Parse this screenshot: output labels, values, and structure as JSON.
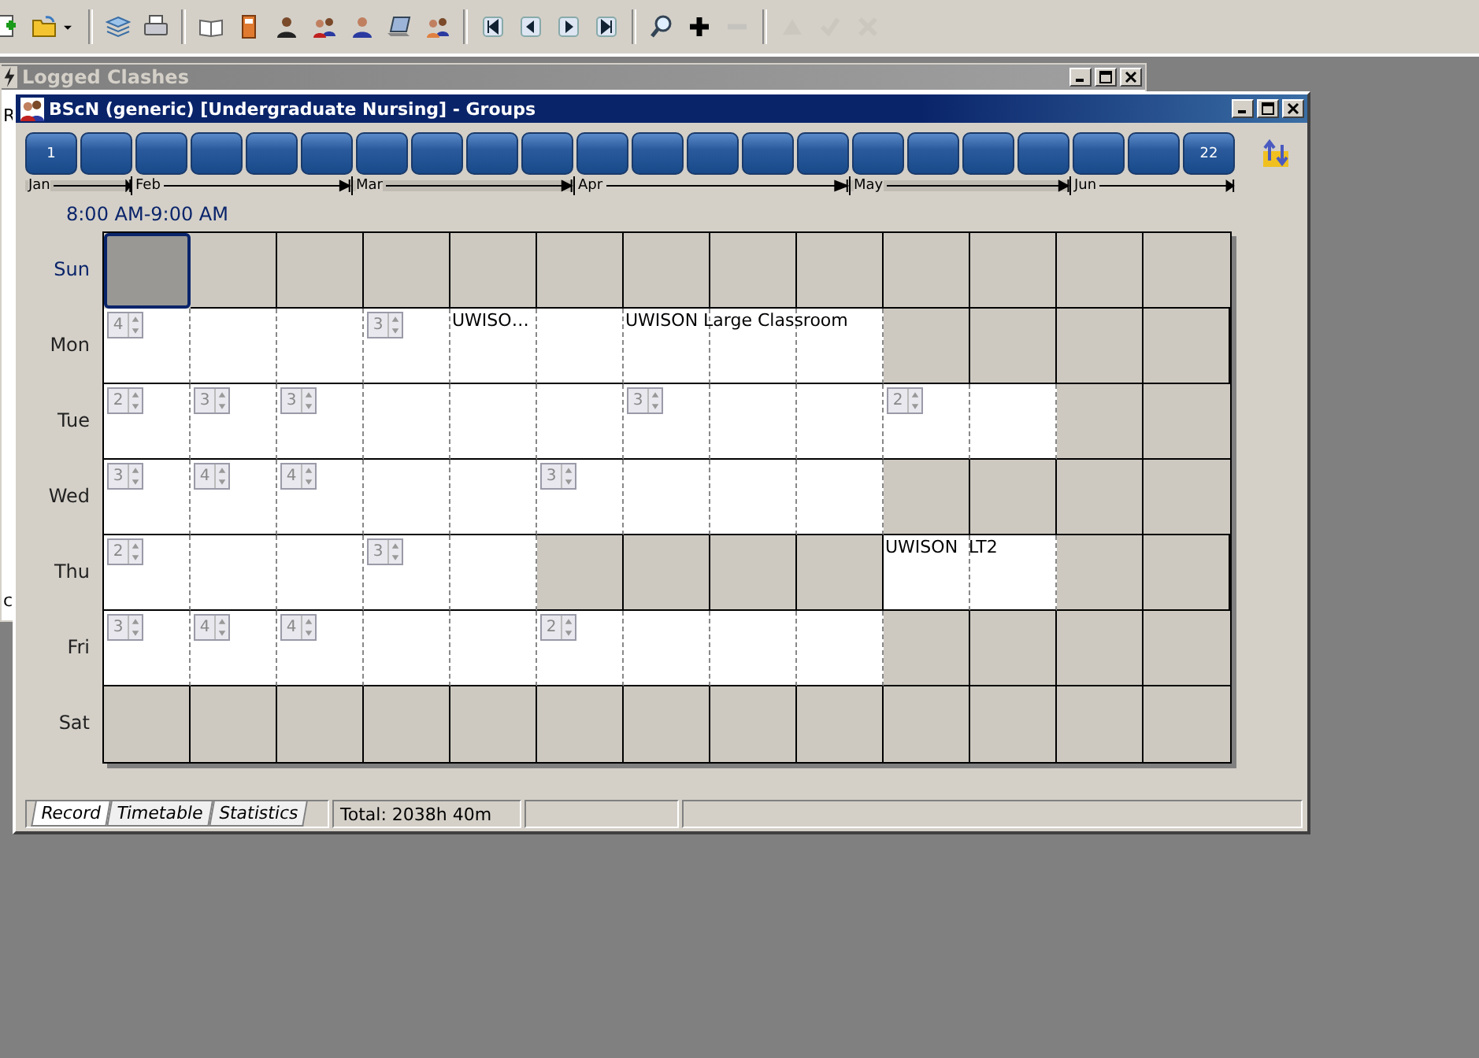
{
  "toolbar": [
    [
      {
        "kind": "new",
        "disabled": false
      },
      {
        "kind": "open",
        "disabled": false
      },
      {
        "kind": "caret",
        "disabled": false
      }
    ],
    [
      {
        "kind": "layers",
        "disabled": false
      },
      {
        "kind": "printer",
        "disabled": false
      }
    ],
    [
      {
        "kind": "book",
        "disabled": false
      },
      {
        "kind": "door",
        "disabled": false
      },
      {
        "kind": "person",
        "disabled": false
      },
      {
        "kind": "people",
        "disabled": false
      },
      {
        "kind": "person2",
        "disabled": false
      },
      {
        "kind": "laptop",
        "disabled": false
      },
      {
        "kind": "people2",
        "disabled": false
      }
    ],
    [
      {
        "kind": "first",
        "disabled": false
      },
      {
        "kind": "prev",
        "disabled": false
      },
      {
        "kind": "next",
        "disabled": false
      },
      {
        "kind": "last",
        "disabled": false
      }
    ],
    [
      {
        "kind": "search",
        "disabled": false
      },
      {
        "kind": "plus",
        "disabled": false
      },
      {
        "kind": "minus",
        "disabled": true
      }
    ],
    [
      {
        "kind": "up",
        "disabled": true
      },
      {
        "kind": "check",
        "disabled": true
      },
      {
        "kind": "cross",
        "disabled": true
      }
    ]
  ],
  "back_window": {
    "title": "Logged Clashes",
    "fragments": [
      "R",
      "c"
    ]
  },
  "window": {
    "title": "BScN (generic) [Undergraduate Nursing] - Groups"
  },
  "weeks": [
    {
      "kind": "numbered",
      "label": "1"
    },
    {
      "kind": "plain"
    },
    {
      "kind": "plain"
    },
    {
      "kind": "plain"
    },
    {
      "kind": "plain"
    },
    {
      "kind": "plain"
    },
    {
      "kind": "plain"
    },
    {
      "kind": "plain"
    },
    {
      "kind": "plain"
    },
    {
      "kind": "plain"
    },
    {
      "kind": "plain"
    },
    {
      "kind": "plain"
    },
    {
      "kind": "plain"
    },
    {
      "kind": "plain"
    },
    {
      "kind": "plain"
    },
    {
      "kind": "plain"
    },
    {
      "kind": "plain"
    },
    {
      "kind": "plain"
    },
    {
      "kind": "plain"
    },
    {
      "kind": "plain"
    },
    {
      "kind": "plain"
    },
    {
      "kind": "numbered",
      "label": "22"
    }
  ],
  "months": [
    "Jan",
    "Feb",
    "Mar",
    "Apr",
    "May",
    "Jun"
  ],
  "time_label": "8:00 AM-9:00 AM",
  "days": [
    {
      "label": "Sun",
      "selected": true,
      "cells": [
        {
          "busy": true,
          "selected": true
        },
        {
          "busy": true,
          "selected": false
        },
        {
          "busy": true,
          "selected": false
        },
        {
          "busy": true,
          "selected": false
        },
        {
          "busy": true,
          "selected": false
        },
        {
          "busy": true,
          "selected": false
        },
        {
          "busy": true,
          "selected": false
        },
        {
          "busy": true,
          "selected": false
        },
        {
          "busy": true,
          "selected": false
        },
        {
          "busy": true,
          "selected": false
        },
        {
          "busy": true,
          "selected": false
        },
        {
          "busy": true,
          "selected": false
        },
        {
          "busy": true,
          "selected": false
        }
      ]
    },
    {
      "label": "Mon",
      "selected": false,
      "cells": [
        {
          "busy": false,
          "selected": false,
          "count": "4"
        },
        {
          "busy": false,
          "selected": false
        },
        {
          "busy": false,
          "selected": false
        },
        {
          "busy": false,
          "selected": false,
          "count": "3"
        },
        {
          "busy": false,
          "selected": false,
          "text": "UWISO…"
        },
        {
          "busy": false,
          "selected": false
        },
        {
          "busy": false,
          "selected": false,
          "text": "UWISON Large Classroom"
        },
        {
          "busy": false,
          "selected": false
        },
        {
          "busy": false,
          "selected": false
        },
        {
          "busy": true,
          "selected": false
        },
        {
          "busy": true,
          "selected": false
        },
        {
          "busy": true,
          "selected": false
        },
        {
          "busy": true,
          "selected": false
        }
      ]
    },
    {
      "label": "Tue",
      "selected": false,
      "cells": [
        {
          "busy": false,
          "selected": false,
          "count": "2"
        },
        {
          "busy": false,
          "selected": false,
          "count": "3"
        },
        {
          "busy": false,
          "selected": false,
          "count": "3"
        },
        {
          "busy": false,
          "selected": false
        },
        {
          "busy": false,
          "selected": false
        },
        {
          "busy": false,
          "selected": false
        },
        {
          "busy": false,
          "selected": false,
          "count": "3"
        },
        {
          "busy": false,
          "selected": false
        },
        {
          "busy": false,
          "selected": false
        },
        {
          "busy": false,
          "selected": false,
          "count": "2"
        },
        {
          "busy": false,
          "selected": false
        },
        {
          "busy": true,
          "selected": false
        },
        {
          "busy": true,
          "selected": false
        }
      ]
    },
    {
      "label": "Wed",
      "selected": false,
      "cells": [
        {
          "busy": false,
          "selected": false,
          "count": "3"
        },
        {
          "busy": false,
          "selected": false,
          "count": "4"
        },
        {
          "busy": false,
          "selected": false,
          "count": "4"
        },
        {
          "busy": false,
          "selected": false
        },
        {
          "busy": false,
          "selected": false
        },
        {
          "busy": false,
          "selected": false,
          "count": "3"
        },
        {
          "busy": false,
          "selected": false
        },
        {
          "busy": false,
          "selected": false
        },
        {
          "busy": false,
          "selected": false
        },
        {
          "busy": true,
          "selected": false
        },
        {
          "busy": true,
          "selected": false
        },
        {
          "busy": true,
          "selected": false
        },
        {
          "busy": true,
          "selected": false
        }
      ]
    },
    {
      "label": "Thu",
      "selected": false,
      "cells": [
        {
          "busy": false,
          "selected": false,
          "count": "2"
        },
        {
          "busy": false,
          "selected": false
        },
        {
          "busy": false,
          "selected": false
        },
        {
          "busy": false,
          "selected": false,
          "count": "3"
        },
        {
          "busy": false,
          "selected": false
        },
        {
          "busy": true,
          "selected": false
        },
        {
          "busy": true,
          "selected": false
        },
        {
          "busy": true,
          "selected": false
        },
        {
          "busy": true,
          "selected": false
        },
        {
          "busy": false,
          "selected": false,
          "text": "UWISON  LT2"
        },
        {
          "busy": false,
          "selected": false
        },
        {
          "busy": true,
          "selected": false
        },
        {
          "busy": true,
          "selected": false
        }
      ]
    },
    {
      "label": "Fri",
      "selected": false,
      "cells": [
        {
          "busy": false,
          "selected": false,
          "count": "3"
        },
        {
          "busy": false,
          "selected": false,
          "count": "4"
        },
        {
          "busy": false,
          "selected": false,
          "count": "4"
        },
        {
          "busy": false,
          "selected": false
        },
        {
          "busy": false,
          "selected": false
        },
        {
          "busy": false,
          "selected": false,
          "count": "2"
        },
        {
          "busy": false,
          "selected": false
        },
        {
          "busy": false,
          "selected": false
        },
        {
          "busy": false,
          "selected": false
        },
        {
          "busy": true,
          "selected": false
        },
        {
          "busy": true,
          "selected": false
        },
        {
          "busy": true,
          "selected": false
        },
        {
          "busy": true,
          "selected": false
        }
      ]
    },
    {
      "label": "Sat",
      "selected": false,
      "cells": [
        {
          "busy": true,
          "selected": false
        },
        {
          "busy": true,
          "selected": false
        },
        {
          "busy": true,
          "selected": false
        },
        {
          "busy": true,
          "selected": false
        },
        {
          "busy": true,
          "selected": false
        },
        {
          "busy": true,
          "selected": false
        },
        {
          "busy": true,
          "selected": false
        },
        {
          "busy": true,
          "selected": false
        },
        {
          "busy": true,
          "selected": false
        },
        {
          "busy": true,
          "selected": false
        },
        {
          "busy": true,
          "selected": false
        },
        {
          "busy": true,
          "selected": false
        },
        {
          "busy": true,
          "selected": false
        }
      ]
    }
  ],
  "tabs": [
    {
      "label": "Record",
      "selected": true
    },
    {
      "label": "Timetable",
      "selected": false
    },
    {
      "label": "Statistics",
      "selected": false
    }
  ],
  "status": [
    "Total: 2038h 40m"
  ]
}
